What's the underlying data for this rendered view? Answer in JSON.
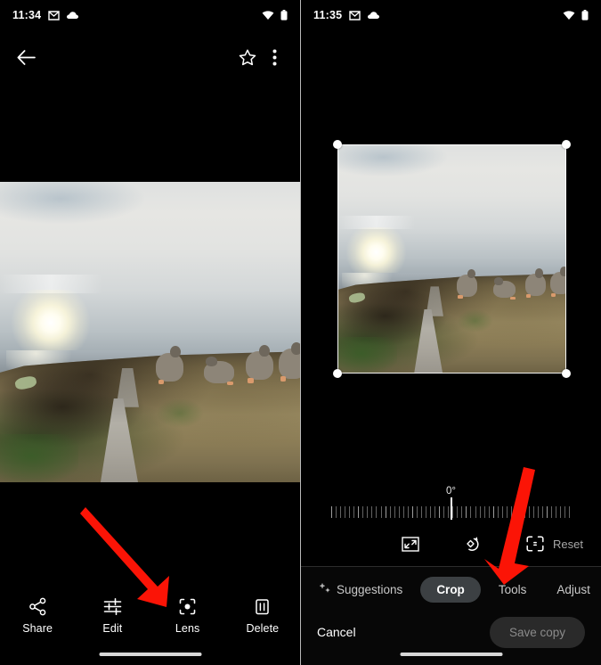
{
  "left_panel": {
    "statusbar": {
      "time": "11:34",
      "icons": [
        "gmail-icon",
        "cloud-icon"
      ],
      "right_icons": [
        "wifi-icon",
        "battery-icon"
      ]
    },
    "appbar": {
      "back": "back-arrow-icon",
      "star": "star-outline-icon",
      "overflow": "more-vert-icon"
    },
    "actions": [
      {
        "label": "Share",
        "icon": "share-icon"
      },
      {
        "label": "Edit",
        "icon": "tune-icon"
      },
      {
        "label": "Lens",
        "icon": "lens-icon"
      },
      {
        "label": "Delete",
        "icon": "trash-icon"
      }
    ]
  },
  "right_panel": {
    "statusbar": {
      "time": "11:35",
      "icons": [
        "gmail-icon",
        "cloud-icon"
      ],
      "right_icons": [
        "wifi-icon",
        "battery-icon"
      ]
    },
    "crop": {
      "handles": [
        "top-left",
        "top-right",
        "bottom-left",
        "bottom-right"
      ],
      "rotation_value": "0°",
      "tools": [
        {
          "name": "aspect-ratio-icon"
        },
        {
          "name": "rotate-icon"
        },
        {
          "name": "auto-straighten-icon"
        }
      ],
      "reset_label": "Reset"
    },
    "modes": [
      {
        "label": "Suggestions",
        "icon": "sparkle-icon",
        "active": false
      },
      {
        "label": "Crop",
        "icon": "",
        "active": true
      },
      {
        "label": "Tools",
        "icon": "",
        "active": false
      },
      {
        "label": "Adjust",
        "icon": "",
        "active": false
      }
    ],
    "cancel_label": "Cancel",
    "save_label": "Save copy"
  },
  "annotations": {
    "arrow_left": "red-arrow-pointing-to-edit",
    "arrow_right": "red-arrow-pointing-to-tools"
  },
  "colors": {
    "background": "#000000",
    "accent_pill": "#3c4043",
    "arrow": "#fb1406",
    "divider": "#b9b9b9"
  }
}
